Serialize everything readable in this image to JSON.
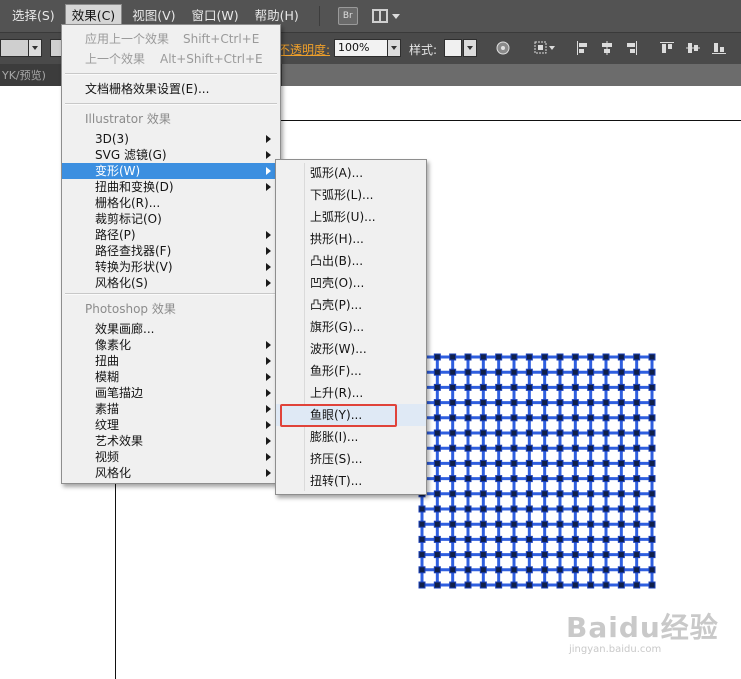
{
  "menubar": {
    "items": [
      "选择(S)",
      "效果(C)",
      "视图(V)",
      "窗口(W)",
      "帮助(H)"
    ],
    "active_index": 1,
    "bridge_badge": "Br"
  },
  "control_bar": {
    "opacity_label": "不透明度:",
    "opacity_value": "100%",
    "style_label": "样式:"
  },
  "doc_tab": {
    "label": "YK/预览)"
  },
  "effect_menu": {
    "apply_last": {
      "label": "应用上一个效果",
      "shortcut": "Shift+Ctrl+E"
    },
    "last_effect": {
      "label": "上一个效果",
      "shortcut": "Alt+Shift+Ctrl+E"
    },
    "doc_raster_settings": "文档栅格效果设置(E)...",
    "illustrator_header": "Illustrator 效果",
    "illustrator_items": [
      {
        "label": "3D(3)",
        "submenu": true
      },
      {
        "label": "SVG 滤镜(G)",
        "submenu": true
      },
      {
        "label": "变形(W)",
        "submenu": true
      },
      {
        "label": "扭曲和变换(D)",
        "submenu": true
      },
      {
        "label": "栅格化(R)...",
        "submenu": false
      },
      {
        "label": "裁剪标记(O)",
        "submenu": false
      },
      {
        "label": "路径(P)",
        "submenu": true
      },
      {
        "label": "路径查找器(F)",
        "submenu": true
      },
      {
        "label": "转换为形状(V)",
        "submenu": true
      },
      {
        "label": "风格化(S)",
        "submenu": true
      }
    ],
    "highlighted_index": 2,
    "photoshop_header": "Photoshop 效果",
    "photoshop_items": [
      {
        "label": "效果画廊...",
        "submenu": false
      },
      {
        "label": "像素化",
        "submenu": true
      },
      {
        "label": "扭曲",
        "submenu": true
      },
      {
        "label": "模糊",
        "submenu": true
      },
      {
        "label": "画笔描边",
        "submenu": true
      },
      {
        "label": "素描",
        "submenu": true
      },
      {
        "label": "纹理",
        "submenu": true
      },
      {
        "label": "艺术效果",
        "submenu": true
      },
      {
        "label": "视频",
        "submenu": true
      },
      {
        "label": "风格化",
        "submenu": true
      }
    ]
  },
  "warp_submenu": {
    "items": [
      "弧形(A)...",
      "下弧形(L)...",
      "上弧形(U)...",
      "拱形(H)...",
      "凸出(B)...",
      "凹壳(O)...",
      "凸壳(P)...",
      "旗形(G)...",
      "波形(W)...",
      "鱼形(F)...",
      "上升(R)...",
      "鱼眼(Y)...",
      "膨胀(I)...",
      "挤压(S)...",
      "扭转(T)..."
    ],
    "hovered_index": 11
  },
  "artwork": {
    "grid_color": "#2f5fe0",
    "grid_cells": 16
  },
  "watermark": {
    "logo": "Baidu经验",
    "url": "jingyan.baidu.com"
  }
}
